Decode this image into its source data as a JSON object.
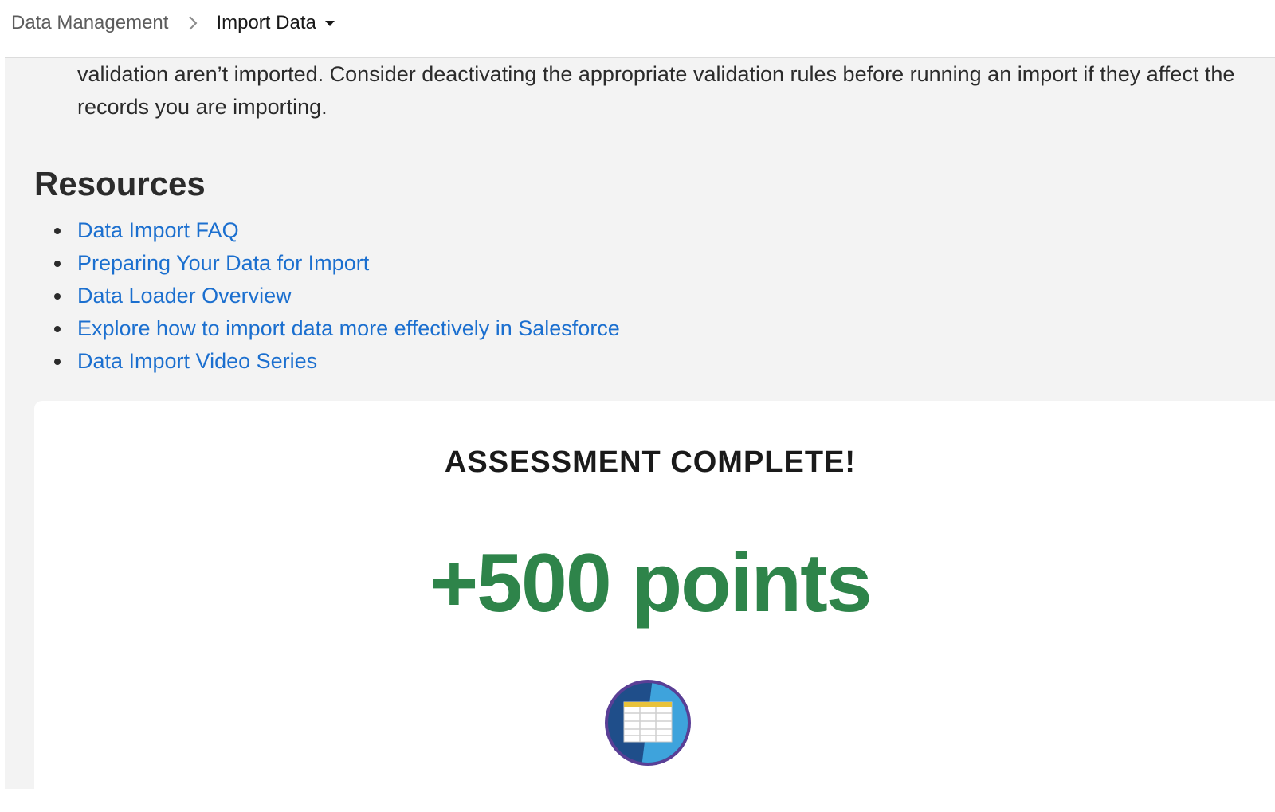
{
  "breadcrumb": {
    "parent": "Data Management",
    "current": "Import Data"
  },
  "intro_text": "validation aren’t imported. Consider deactivating the appropriate validation rules before running an import if they affect the records you are importing.",
  "resources": {
    "title": "Resources",
    "links": [
      {
        "label": "Data Import FAQ"
      },
      {
        "label": "Preparing Your Data for Import"
      },
      {
        "label": "Data Loader Overview"
      },
      {
        "label": "Explore how to import data more effectively in Salesforce"
      },
      {
        "label": "Data Import Video Series"
      }
    ]
  },
  "assessment": {
    "title": "ASSESSMENT COMPLETE!",
    "points": "+500 points",
    "badge_icon": "spreadsheet-badge-icon"
  },
  "colors": {
    "link": "#1b6fcf",
    "points": "#2e844a",
    "content_bg": "#f3f3f3"
  }
}
